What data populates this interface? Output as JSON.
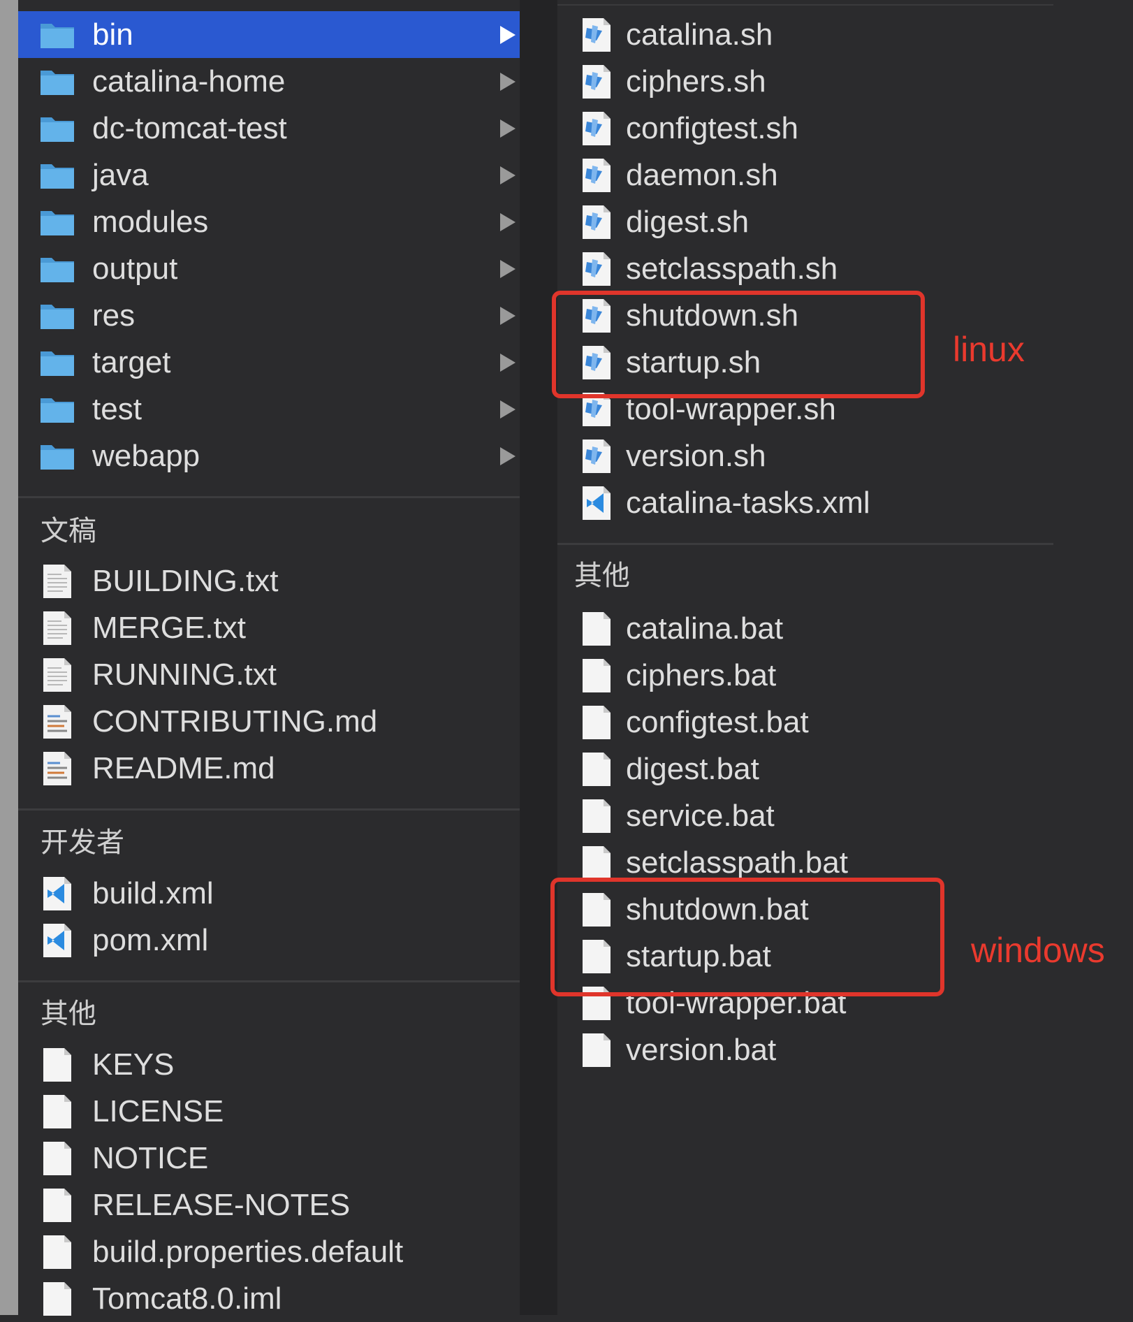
{
  "column1": {
    "folders": [
      {
        "label": "bin",
        "selected": true
      },
      {
        "label": "catalina-home"
      },
      {
        "label": "dc-tomcat-test"
      },
      {
        "label": "java"
      },
      {
        "label": "modules"
      },
      {
        "label": "output"
      },
      {
        "label": "res"
      },
      {
        "label": "target"
      },
      {
        "label": "test"
      },
      {
        "label": "webapp"
      }
    ],
    "sections": [
      {
        "title": "文稿",
        "items": [
          {
            "label": "BUILDING.txt",
            "icon": "text-file-icon"
          },
          {
            "label": "MERGE.txt",
            "icon": "text-file-icon"
          },
          {
            "label": "RUNNING.txt",
            "icon": "text-file-icon"
          },
          {
            "label": "CONTRIBUTING.md",
            "icon": "markdown-file-icon"
          },
          {
            "label": "README.md",
            "icon": "markdown-file-icon"
          }
        ]
      },
      {
        "title": "开发者",
        "items": [
          {
            "label": "build.xml",
            "icon": "vscode-xml-icon"
          },
          {
            "label": "pom.xml",
            "icon": "vscode-xml-icon"
          }
        ]
      },
      {
        "title": "其他",
        "items": [
          {
            "label": "KEYS",
            "icon": "blank-file-icon"
          },
          {
            "label": "LICENSE",
            "icon": "blank-file-icon"
          },
          {
            "label": "NOTICE",
            "icon": "blank-file-icon"
          },
          {
            "label": "RELEASE-NOTES",
            "icon": "blank-file-icon"
          },
          {
            "label": "build.properties.default",
            "icon": "blank-file-icon"
          },
          {
            "label": "Tomcat8.0.iml",
            "icon": "blank-file-icon"
          }
        ]
      }
    ]
  },
  "column2": {
    "files": [
      {
        "label": "catalina.sh",
        "icon": "shell-script-icon"
      },
      {
        "label": "ciphers.sh",
        "icon": "shell-script-icon"
      },
      {
        "label": "configtest.sh",
        "icon": "shell-script-icon"
      },
      {
        "label": "daemon.sh",
        "icon": "shell-script-icon"
      },
      {
        "label": "digest.sh",
        "icon": "shell-script-icon"
      },
      {
        "label": "setclasspath.sh",
        "icon": "shell-script-icon"
      },
      {
        "label": "shutdown.sh",
        "icon": "shell-script-icon"
      },
      {
        "label": "startup.sh",
        "icon": "shell-script-icon"
      },
      {
        "label": "tool-wrapper.sh",
        "icon": "shell-script-icon"
      },
      {
        "label": "version.sh",
        "icon": "shell-script-icon"
      },
      {
        "label": "catalina-tasks.xml",
        "icon": "vscode-xml-icon"
      }
    ],
    "sections": [
      {
        "title": "其他",
        "items": [
          {
            "label": "catalina.bat",
            "icon": "blank-file-icon"
          },
          {
            "label": "ciphers.bat",
            "icon": "blank-file-icon"
          },
          {
            "label": "configtest.bat",
            "icon": "blank-file-icon"
          },
          {
            "label": "digest.bat",
            "icon": "blank-file-icon"
          },
          {
            "label": "service.bat",
            "icon": "blank-file-icon"
          },
          {
            "label": "setclasspath.bat",
            "icon": "blank-file-icon"
          },
          {
            "label": "shutdown.bat",
            "icon": "blank-file-icon"
          },
          {
            "label": "startup.bat",
            "icon": "blank-file-icon"
          },
          {
            "label": "tool-wrapper.bat",
            "icon": "blank-file-icon"
          },
          {
            "label": "version.bat",
            "icon": "blank-file-icon"
          }
        ]
      }
    ]
  },
  "annotations": {
    "linux": "linux",
    "windows": "windows",
    "color": "#e0352b"
  },
  "colors": {
    "background": "#2b2b2d",
    "selection": "#2a59d1",
    "folder": "#5fb0e6"
  }
}
